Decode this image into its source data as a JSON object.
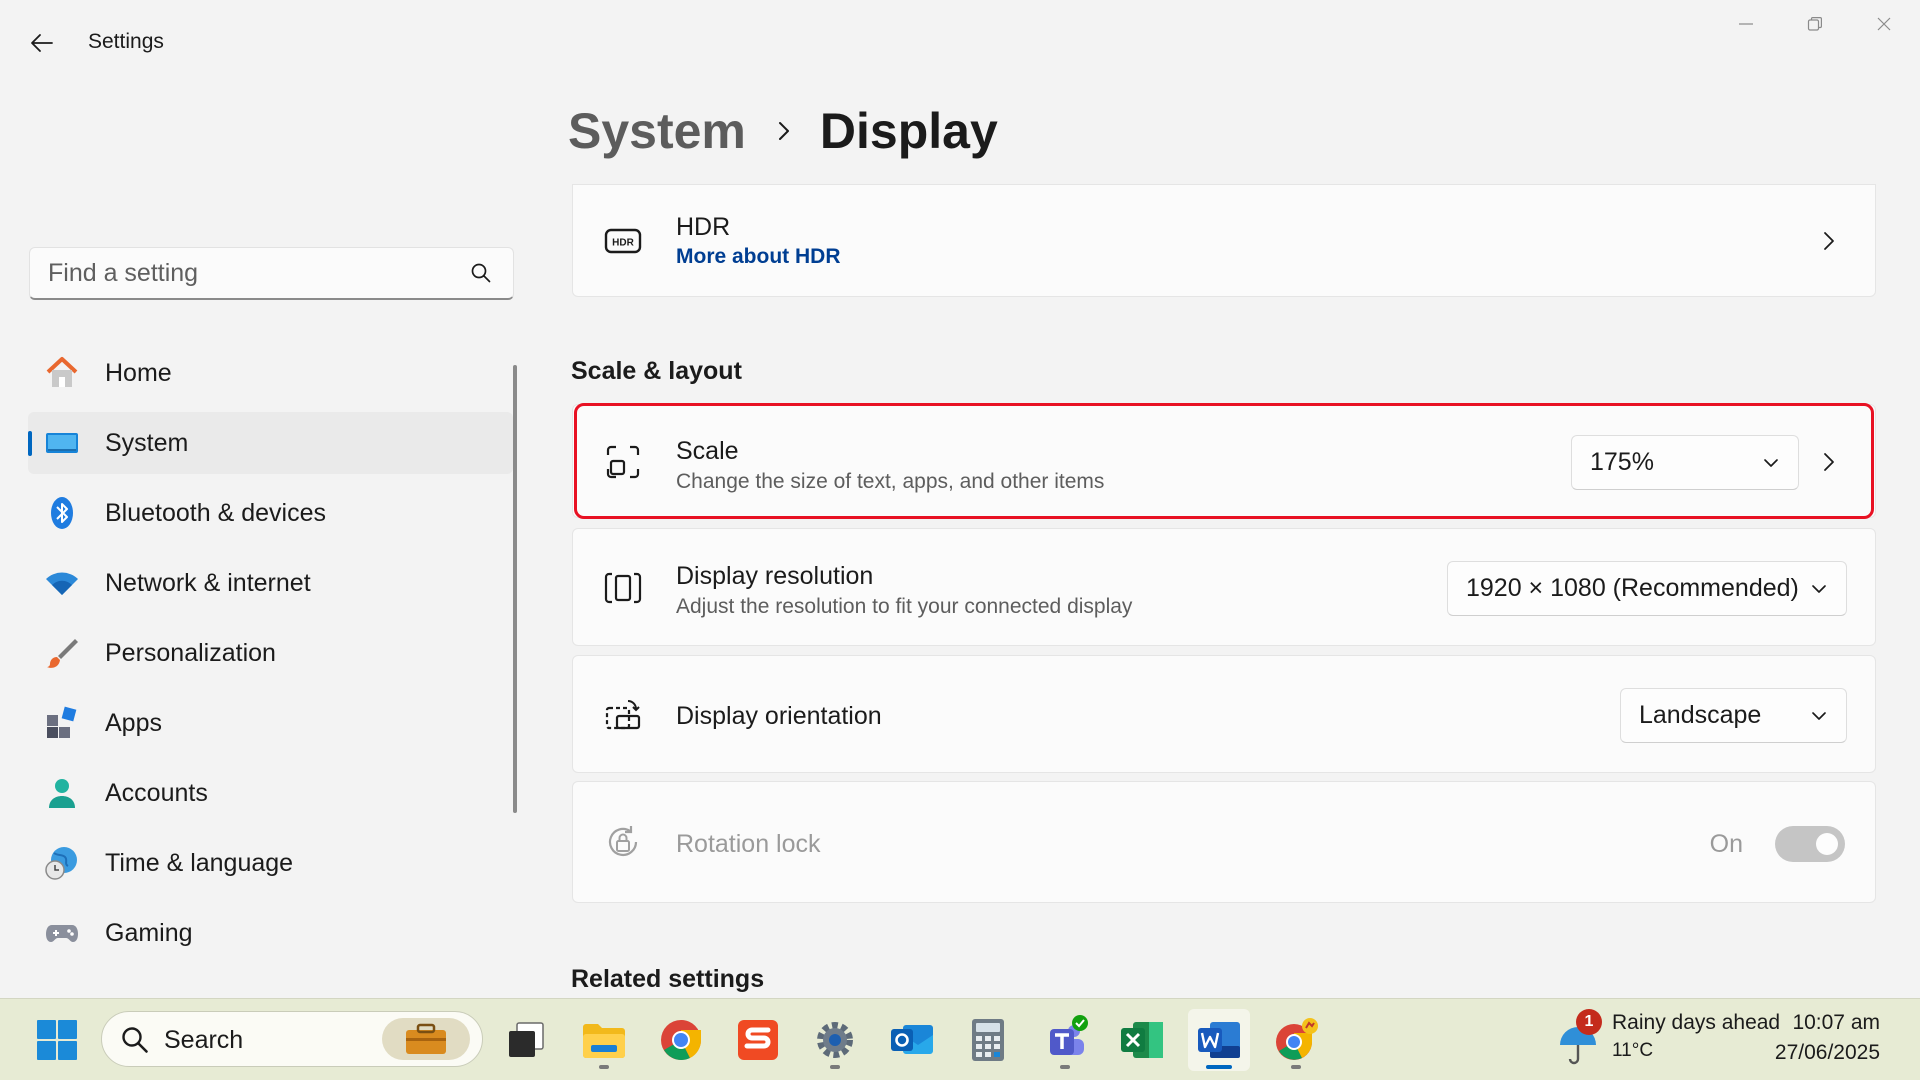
{
  "window": {
    "title": "Settings"
  },
  "breadcrumb": {
    "parent": "System",
    "current": "Display"
  },
  "search": {
    "placeholder": "Find a setting"
  },
  "sidebar": {
    "items": [
      {
        "label": "Home",
        "icon": "home-icon"
      },
      {
        "label": "System",
        "icon": "system-icon",
        "selected": true
      },
      {
        "label": "Bluetooth & devices",
        "icon": "bluetooth-icon"
      },
      {
        "label": "Network & internet",
        "icon": "wifi-icon"
      },
      {
        "label": "Personalization",
        "icon": "brush-icon"
      },
      {
        "label": "Apps",
        "icon": "apps-icon"
      },
      {
        "label": "Accounts",
        "icon": "person-icon"
      },
      {
        "label": "Time & language",
        "icon": "globe-clock-icon"
      },
      {
        "label": "Gaming",
        "icon": "gamepad-icon"
      }
    ]
  },
  "hdr": {
    "title": "HDR",
    "link": "More about HDR"
  },
  "scale_layout": {
    "header": "Scale & layout",
    "scale": {
      "title": "Scale",
      "subtitle": "Change the size of text, apps, and other items",
      "value": "175%"
    },
    "resolution": {
      "title": "Display resolution",
      "subtitle": "Adjust the resolution to fit your connected display",
      "value": "1920 × 1080 (Recommended)"
    },
    "orientation": {
      "title": "Display orientation",
      "value": "Landscape"
    },
    "rotation_lock": {
      "title": "Rotation lock",
      "state": "On"
    }
  },
  "related": {
    "header": "Related settings"
  },
  "taskbar": {
    "search_label": "Search",
    "weather_title": "Rainy days ahead",
    "weather_temp": "11°C",
    "weather_badge": "1",
    "time": "10:07 am",
    "date": "27/06/2025"
  },
  "colors": {
    "accent": "#0067c0",
    "highlight": "#e81123",
    "link": "#003e92"
  }
}
